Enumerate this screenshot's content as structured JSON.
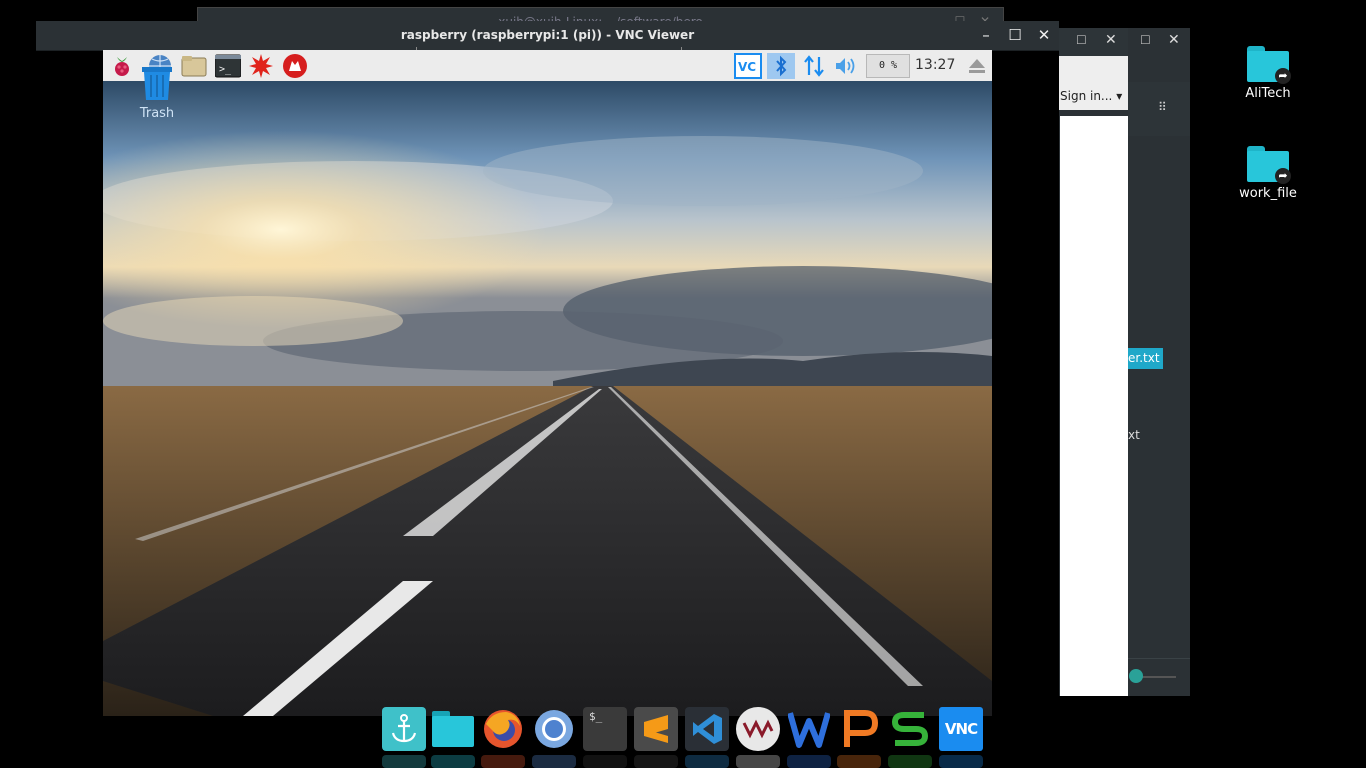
{
  "background_windows": {
    "terminal_title": "xuih@xuih-Linux: ~/software/bero",
    "browser_signin": "Sign in...",
    "files_selected_fragment": "er.txt",
    "files_item_fragment": "xt"
  },
  "desktop_icons": [
    {
      "label": "AliTech",
      "icon": "shared-folder-icon"
    },
    {
      "label": "work_file",
      "icon": "shared-folder-icon"
    }
  ],
  "vnc_window": {
    "title": "raspberry (raspberrypi:1 (pi)) - VNC Viewer",
    "buttons": [
      "minimize",
      "maximize",
      "close"
    ]
  },
  "remote_desktop": {
    "panel": {
      "launchers": [
        "raspberry-menu-icon",
        "web-browser-icon",
        "file-manager-icon",
        "terminal-icon",
        "burst-app-icon",
        "wolfram-icon"
      ],
      "tray": [
        "vnc-icon",
        "bluetooth-icon",
        "network-icon",
        "volume-icon"
      ],
      "cpu_usage": "0 %",
      "clock": "13:27",
      "eject": "eject-icon"
    },
    "desktop_items": [
      {
        "label": "Trash"
      }
    ]
  },
  "dock": {
    "items": [
      {
        "name": "anchor-app",
        "color": "#3fc1c9"
      },
      {
        "name": "files",
        "color": "#1fb5c9"
      },
      {
        "name": "firefox",
        "color": "#e6552d"
      },
      {
        "name": "chromium",
        "color": "#5a8fd6"
      },
      {
        "name": "terminal",
        "color": "#3a3a3a"
      },
      {
        "name": "sublime-text",
        "color": "#4a4a4a"
      },
      {
        "name": "vscode",
        "color": "#2a2f36"
      },
      {
        "name": "vm-app",
        "color": "#e8e8e8"
      },
      {
        "name": "wps-writer",
        "color": "#2e6fdc"
      },
      {
        "name": "wps-presentation",
        "color": "#f07a24"
      },
      {
        "name": "wps-spreadsheet",
        "color": "#36b33a"
      },
      {
        "name": "vnc-viewer",
        "color": "#1a8cf0"
      }
    ],
    "terminal_glyph": "$_",
    "vnc_glyph": "VNC"
  }
}
